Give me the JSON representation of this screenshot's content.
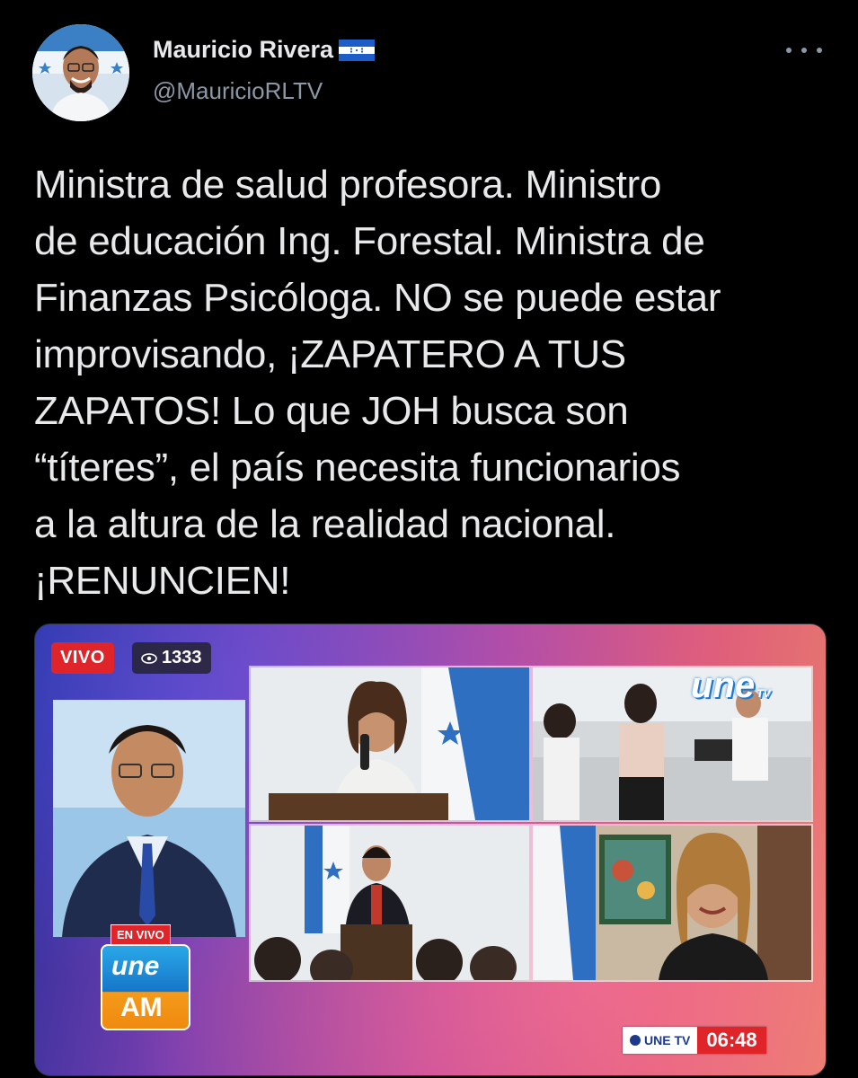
{
  "author": {
    "display_name": "Mauricio Rivera",
    "handle": "@MauricioRLTV",
    "flag_icon": "honduras-flag-icon",
    "avatar_icon": "profile-photo"
  },
  "tweet": {
    "text": "Ministra de salud profesora. Ministro\nde educación Ing. Forestal. Ministra de\nFinanzas Psicóloga. NO se puede estar\nimprovisando, ¡ZAPATERO A TUS\nZAPATOS! Lo que JOH busca son\n“títeres”, el país necesita funcionarios\na la altura de la realidad nacional.\n¡RENUNCIEN!"
  },
  "media": {
    "live_label": "VIVO",
    "viewer_count": "1333",
    "en_vivo_tag": "EN VIVO",
    "logo_une": "une",
    "logo_tv": "TV",
    "logo_am": "AM",
    "channel_bug_label": "UNE TV",
    "clock": "06:48"
  },
  "colors": {
    "background": "#000000",
    "text": "#e7e9ea",
    "secondary_text": "#8b98a5",
    "live_red": "#e0252a"
  }
}
